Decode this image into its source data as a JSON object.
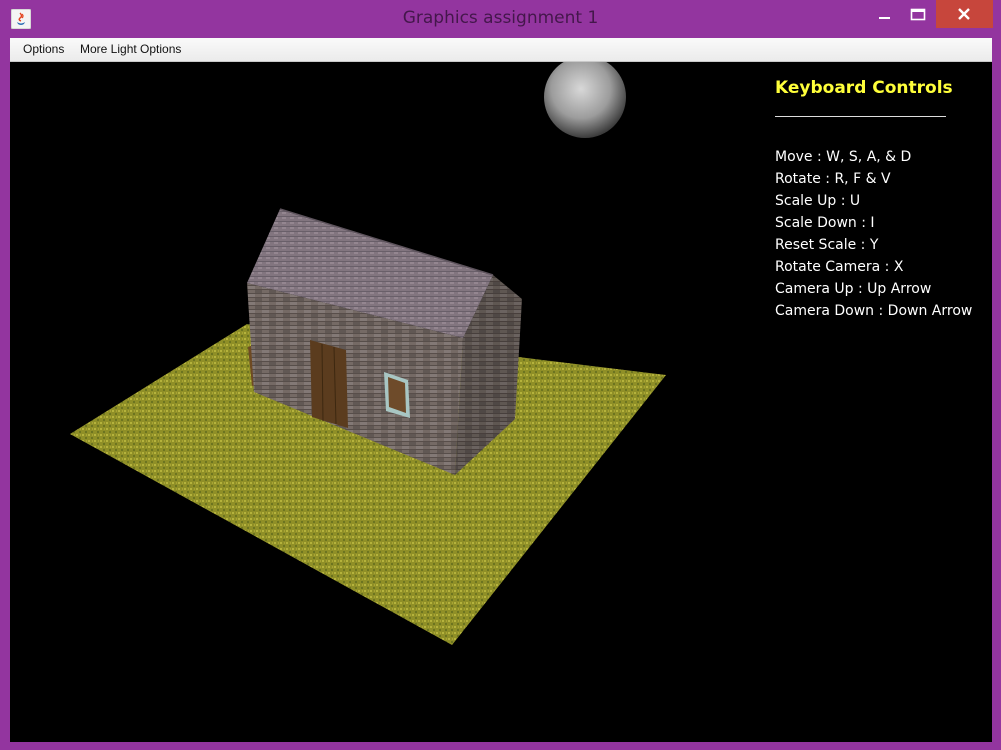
{
  "window": {
    "title": "Graphics assignment 1",
    "frame_color": "#93359f",
    "close_color": "#c7463c"
  },
  "menu": {
    "items": [
      {
        "label": "Options"
      },
      {
        "label": "More Light Options"
      }
    ]
  },
  "controls": {
    "title": "Keyboard Controls",
    "title_color": "#ffff3a",
    "items": [
      "Move : W, S, A, & D",
      "Rotate : R, F & V",
      "Scale Up : U",
      "Scale Down : I",
      "Reset Scale : Y",
      "Rotate Camera : X",
      "Camera Up : Up Arrow",
      "Camera Down : Down Arrow"
    ]
  },
  "scene": {
    "background": "#000000",
    "ground": "grass",
    "ground_color": "#9a9a2e",
    "house_wall": "stone",
    "house_roof": "shingles",
    "moon": "moon"
  },
  "icons": {
    "app": "java-icon",
    "minimize": "minimize-icon",
    "maximize": "maximize-icon",
    "close": "close-icon"
  }
}
